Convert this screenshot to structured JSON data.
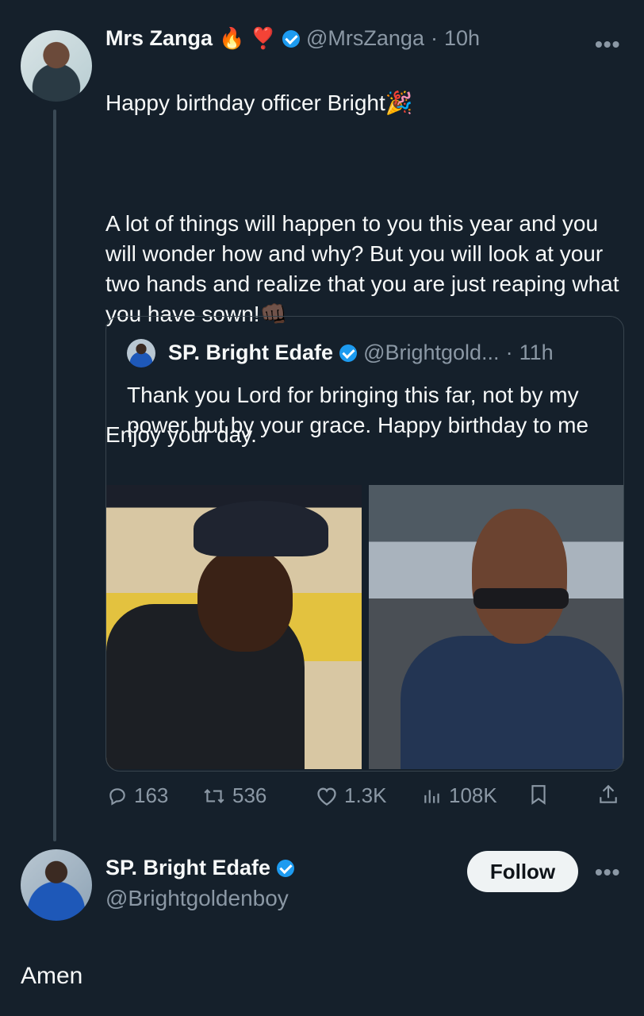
{
  "tweet": {
    "author_name": "Mrs Zanga",
    "author_emojis": "🔥 ❣️",
    "author_handle": "@MrsZanga",
    "time": "10h",
    "separator": "·",
    "line1": "Happy birthday officer Bright",
    "line1_emoji": "🎉",
    "body": "A lot of things will happen to you this year and you will wonder how and why? But you will look at your two hands and realize that you are just reaping what you have sown!",
    "body_emoji": "👊🏿",
    "closing": "Enjoy your day."
  },
  "quote": {
    "author_name": "SP. Bright Edafe",
    "author_handle": "@Brightgold...",
    "time": "11h",
    "text": "Thank you Lord for bringing this far, not by my power but by your grace. Happy birthday to me"
  },
  "actions": {
    "replies": "163",
    "retweets": "536",
    "likes": "1.3K",
    "views": "108K"
  },
  "reply_author": {
    "name": "SP. Bright Edafe",
    "handle": "@Brightgoldenboy",
    "follow_label": "Follow",
    "reply_text": "Amen"
  },
  "icons": {
    "more": "more-dots-icon",
    "verified": "verified-badge-icon",
    "reply": "reply-icon",
    "retweet": "retweet-icon",
    "like": "heart-icon",
    "views": "views-icon",
    "bookmark": "bookmark-icon",
    "share": "share-icon"
  },
  "colors": {
    "background": "#15202b",
    "verified": "#1d9bf0",
    "muted": "#8b98a5"
  }
}
